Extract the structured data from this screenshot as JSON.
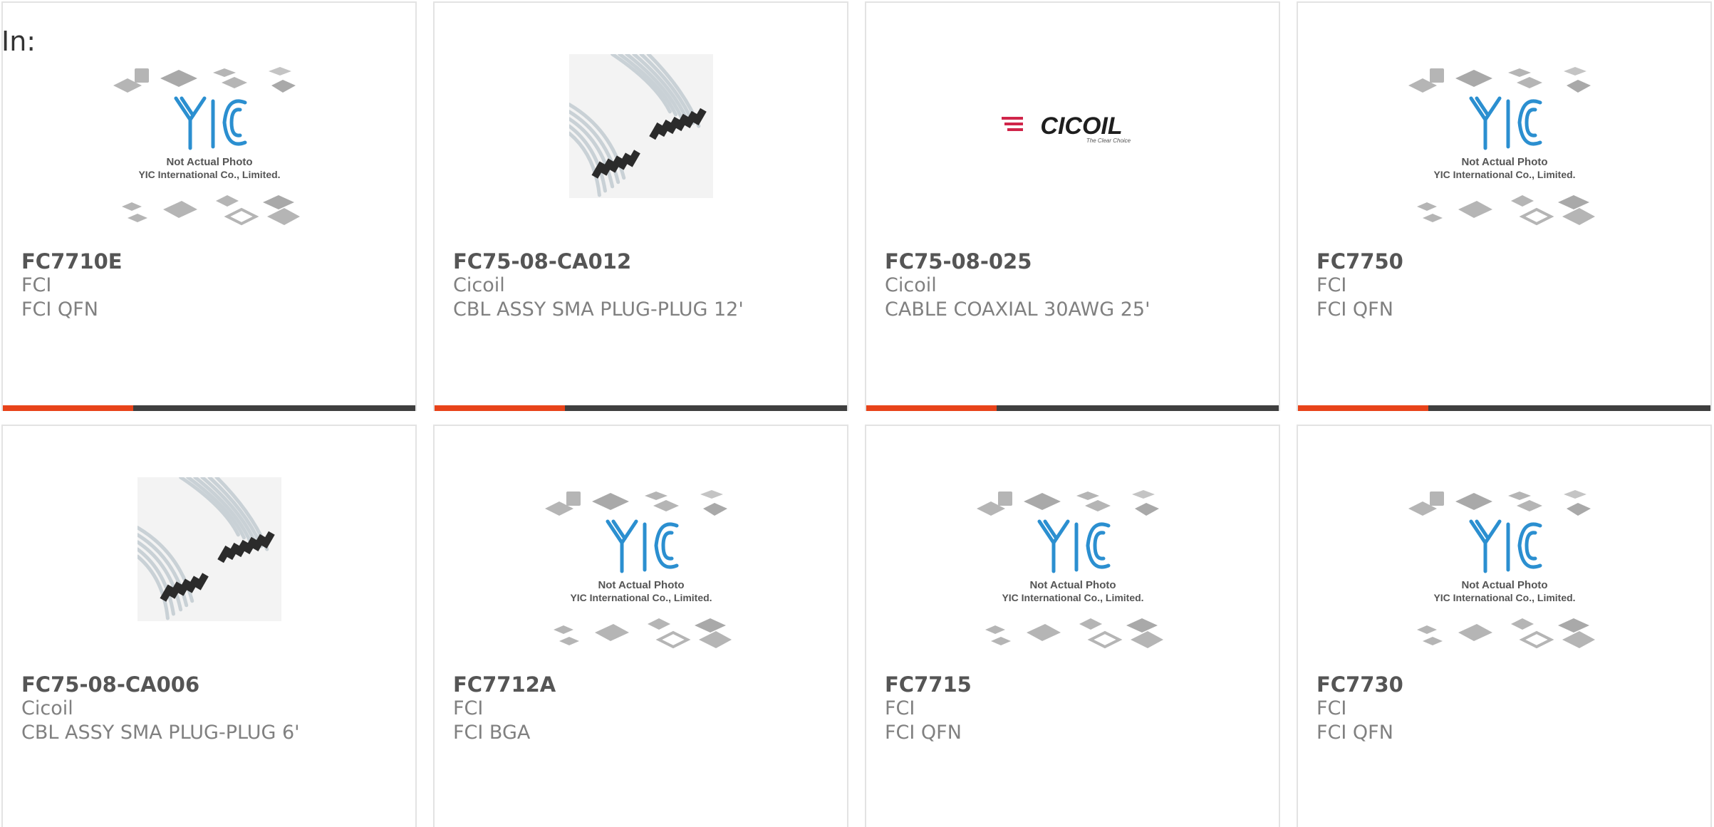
{
  "heading": "In:",
  "colors": {
    "accent": "#e8431a",
    "bar": "#3f3f3f",
    "border": "#e3e3e3",
    "part_no": "#555555",
    "meta": "#808080",
    "yic_blue": "#2b8fd0",
    "cicoil_red": "#d0254a"
  },
  "placeholder_image": {
    "line1": "Not Actual Photo",
    "line2": "YIC International Co., Limited.",
    "logo_text": "YIC"
  },
  "cicoil_logo": {
    "text": "CICOIL",
    "tagline": "The Clear Choice"
  },
  "products": [
    {
      "part_no": "FC7710E",
      "maker": "FCI",
      "desc": "FCI QFN",
      "image": "placeholder"
    },
    {
      "part_no": "FC75-08-CA012",
      "maker": "Cicoil",
      "desc": "CBL ASSY SMA PLUG-PLUG 12'",
      "image": "cable-photo"
    },
    {
      "part_no": "FC75-08-025",
      "maker": "Cicoil",
      "desc": "CABLE COAXIAL 30AWG 25'",
      "image": "cicoil-logo"
    },
    {
      "part_no": "FC7750",
      "maker": "FCI",
      "desc": "FCI QFN",
      "image": "placeholder"
    },
    {
      "part_no": "FC75-08-CA006",
      "maker": "Cicoil",
      "desc": "CBL ASSY SMA PLUG-PLUG 6'",
      "image": "cable-photo"
    },
    {
      "part_no": "FC7712A",
      "maker": "FCI",
      "desc": "FCI BGA",
      "image": "placeholder"
    },
    {
      "part_no": "FC7715",
      "maker": "FCI",
      "desc": "FCI QFN",
      "image": "placeholder"
    },
    {
      "part_no": "FC7730",
      "maker": "FCI",
      "desc": "FCI QFN",
      "image": "placeholder"
    }
  ]
}
